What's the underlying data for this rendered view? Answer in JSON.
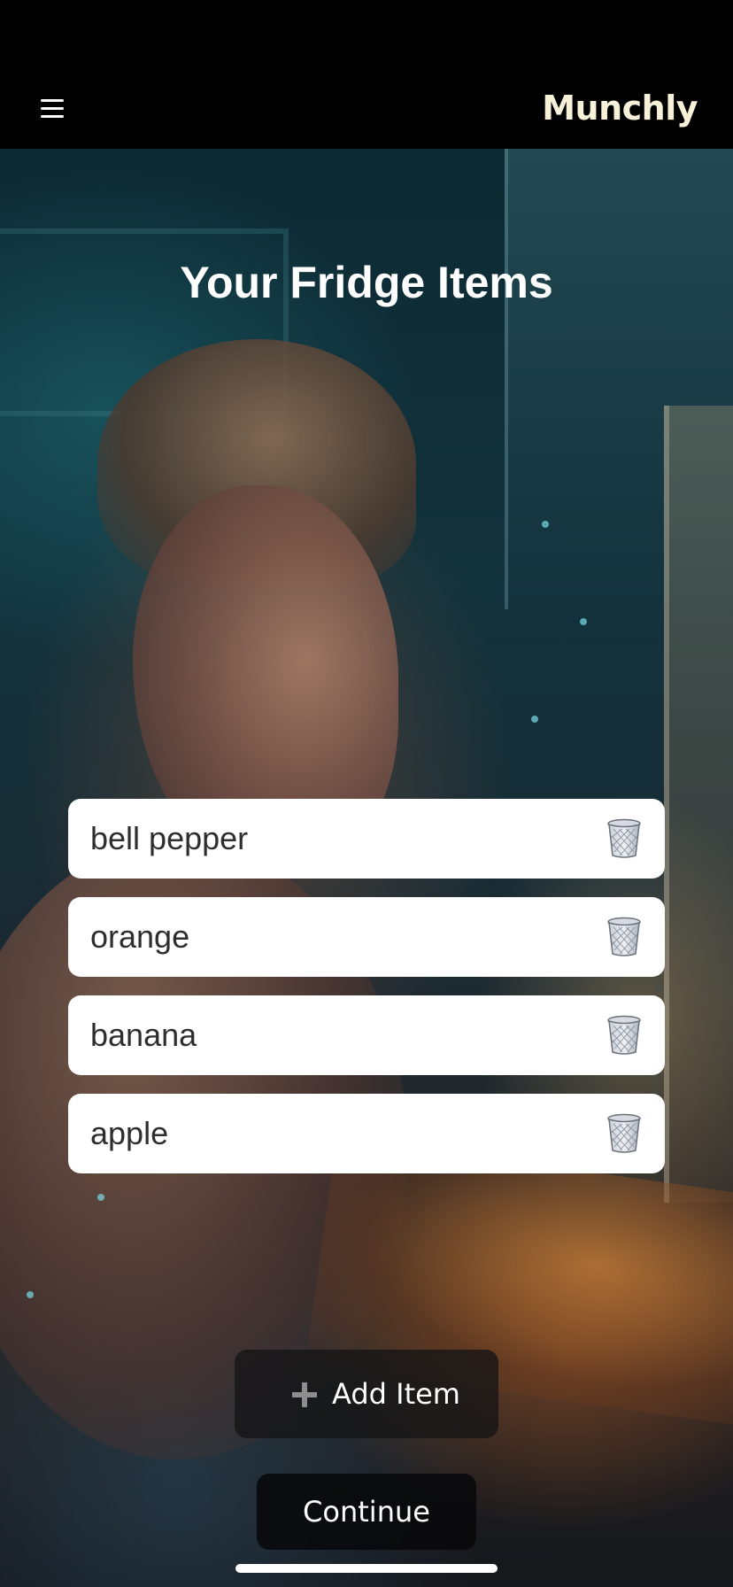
{
  "app": {
    "logo_text": "Munchly"
  },
  "header": {
    "menu_icon": "hamburger-menu-icon"
  },
  "main": {
    "title": "Your Fridge Items",
    "items": [
      {
        "label": "bell pepper",
        "action_icon": "trash-can-icon"
      },
      {
        "label": "orange",
        "action_icon": "trash-can-icon"
      },
      {
        "label": "banana",
        "action_icon": "trash-can-icon"
      },
      {
        "label": "apple",
        "action_icon": "trash-can-icon"
      }
    ]
  },
  "actions": {
    "add_item_label": "Add Item",
    "add_item_icon": "plus-icon",
    "continue_label": "Continue"
  },
  "colors": {
    "card_background": "#ffffff",
    "logo_color": "#f7f1d9",
    "button_background": "#141416"
  }
}
